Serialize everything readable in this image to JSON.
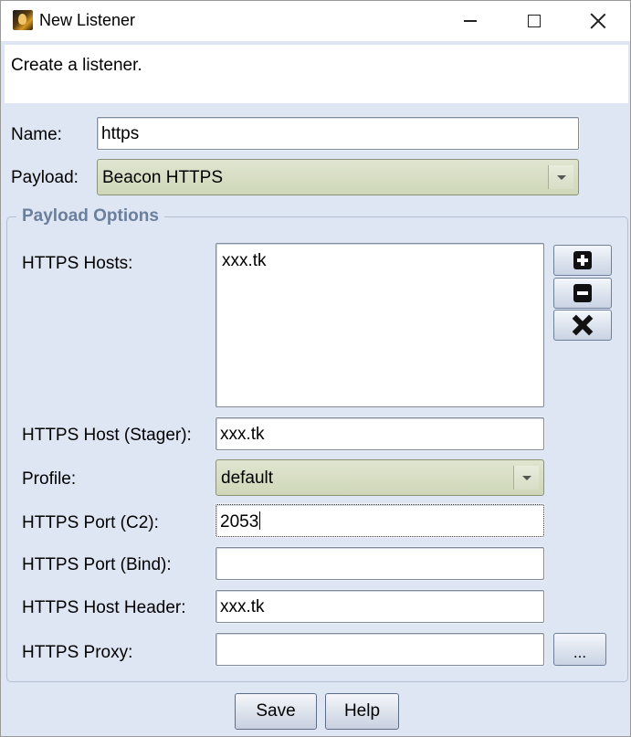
{
  "window": {
    "title": "New Listener",
    "description": "Create a listener."
  },
  "form": {
    "name_label": "Name:",
    "name_value": "https",
    "payload_label": "Payload:",
    "payload_value": "Beacon HTTPS"
  },
  "payload_options": {
    "title": "Payload Options",
    "hosts_label": "HTTPS Hosts:",
    "hosts": [
      "xxx.tk"
    ],
    "stager_label": "HTTPS Host (Stager):",
    "stager_value": "xxx.tk",
    "profile_label": "Profile:",
    "profile_value": "default",
    "port_c2_label": "HTTPS Port (C2):",
    "port_c2_value": "2053",
    "port_bind_label": "HTTPS Port (Bind):",
    "port_bind_value": "",
    "host_header_label": "HTTPS Host Header:",
    "host_header_value": "xxx.tk",
    "proxy_label": "HTTPS Proxy:",
    "proxy_value": "",
    "proxy_button_label": "...",
    "host_buttons": [
      "plus-icon",
      "minus-icon",
      "x-icon"
    ]
  },
  "buttons": {
    "save": "Save",
    "help": "Help"
  }
}
